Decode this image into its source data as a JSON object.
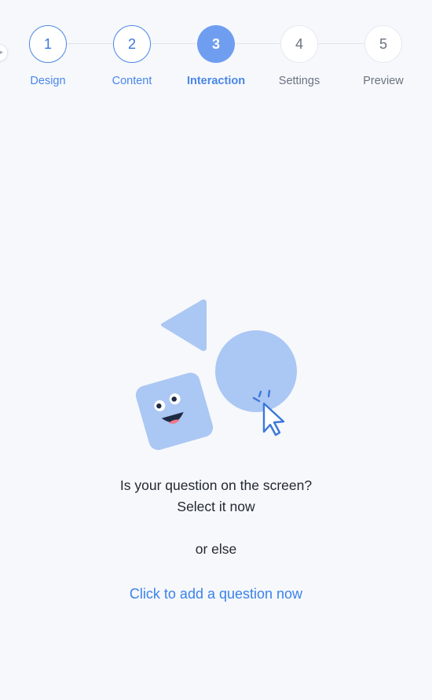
{
  "stepper": {
    "steps": [
      {
        "number": "1",
        "label": "Design",
        "state": "done"
      },
      {
        "number": "2",
        "label": "Content",
        "state": "done"
      },
      {
        "number": "3",
        "label": "Interaction",
        "state": "active"
      },
      {
        "number": "4",
        "label": "Settings",
        "state": "pending"
      },
      {
        "number": "5",
        "label": "Preview",
        "state": "pending"
      }
    ]
  },
  "empty_state": {
    "line1": "Is your question on the screen?",
    "line2": "Select it now",
    "separator": "or else",
    "add_link": "Click to add a question now"
  },
  "colors": {
    "accent": "#4a86e8",
    "active_step": "#6f9ef0",
    "illustration": "#abc7f3",
    "background": "#f6f8fc"
  },
  "icons": {
    "collapse_handle": "chevron-right-icon",
    "illustration": "shapes-with-cursor-illustration"
  }
}
